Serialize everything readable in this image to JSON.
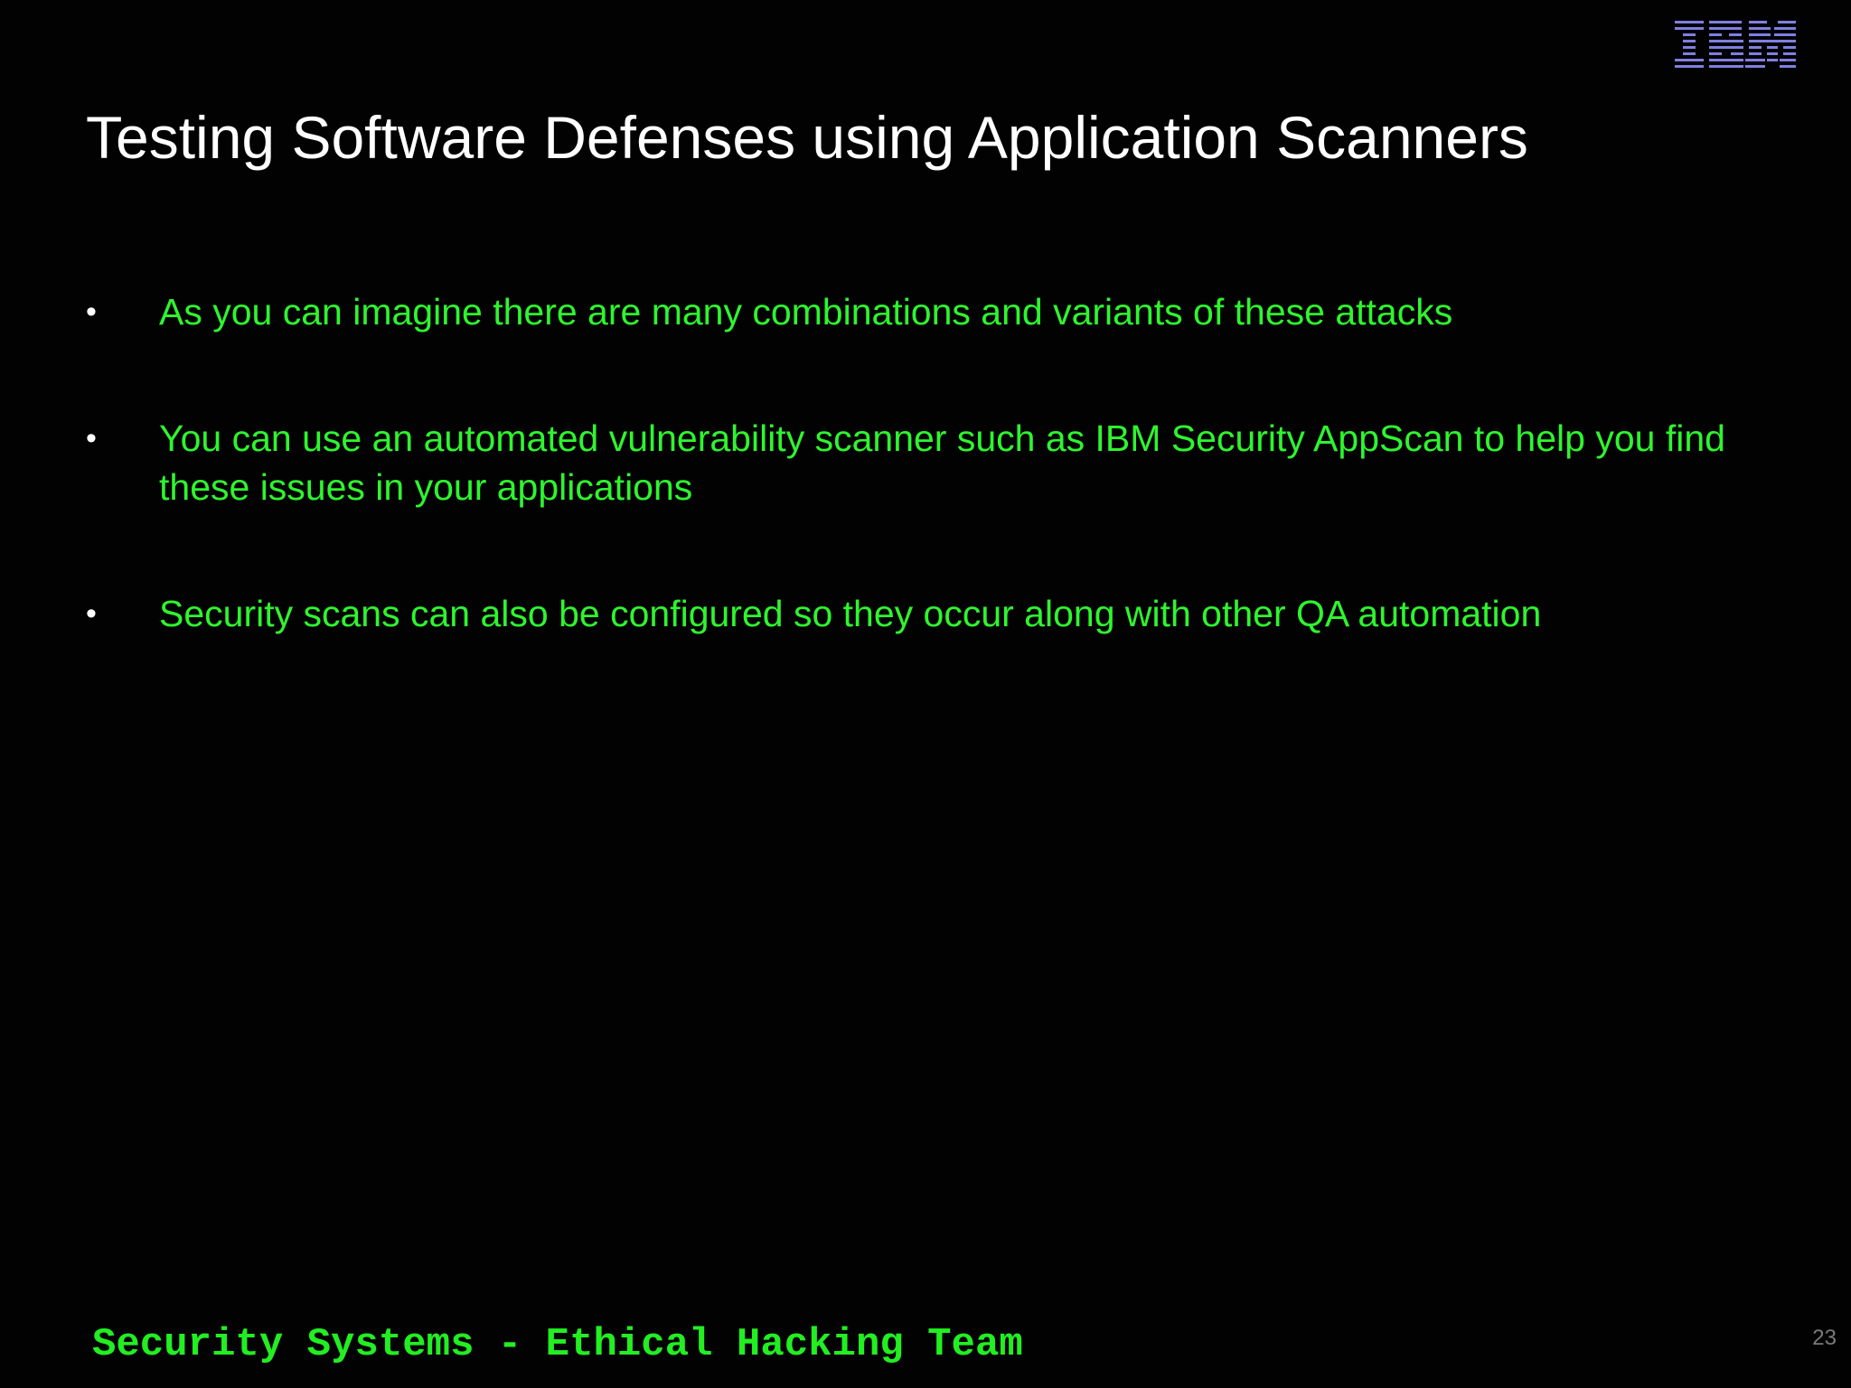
{
  "slide": {
    "title": "Testing Software Defenses using Application Scanners",
    "bullets": [
      {
        "marker": "•",
        "text": "As you can imagine there are many combinations and variants of these attacks"
      },
      {
        "marker": "•",
        "text": "You can use an automated vulnerability scanner such as IBM Security AppScan to help you find these issues in your applications"
      },
      {
        "marker": "•",
        "text": "Security scans can also be configured so they occur along with other QA automation"
      }
    ],
    "footer": "Security Systems - Ethical Hacking Team",
    "page_number": "23"
  },
  "logo": {
    "icon": "ibm-logo-icon",
    "text": "IBM",
    "color": "#7f7fe0"
  },
  "colors": {
    "background": "#030203",
    "title": "#ffffff",
    "bullet_text": "#2ef52e",
    "footer_text": "#22ee22",
    "page_number": "#7a7a7a"
  }
}
